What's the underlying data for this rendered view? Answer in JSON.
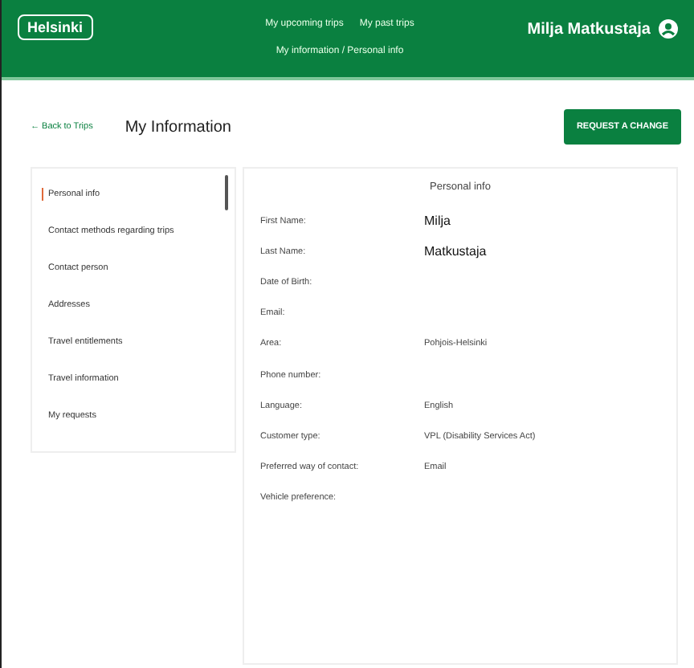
{
  "header": {
    "logo": "Helsinki",
    "nav": [
      {
        "label": "My upcoming trips",
        "selected": false
      },
      {
        "label": "My past trips",
        "selected": false
      }
    ],
    "breadcrumb": "My information / Personal info",
    "user_name": "Milja Matkustaja"
  },
  "toolbar": {
    "back_link": "← Back to Trips",
    "title": "My Information",
    "action_button": "REQUEST A CHANGE"
  },
  "sidebar": {
    "items": [
      {
        "label": "Personal info",
        "selected": true
      },
      {
        "label": "Contact methods regarding trips",
        "selected": false
      },
      {
        "label": "Contact person",
        "selected": false
      },
      {
        "label": "Addresses",
        "selected": false
      },
      {
        "label": "Travel entitlements",
        "selected": false
      },
      {
        "label": "Travel information",
        "selected": false
      },
      {
        "label": "My requests",
        "selected": false
      }
    ]
  },
  "panel": {
    "title": "Personal info",
    "fields": [
      {
        "label": "First Name:",
        "value": "Milja",
        "kind": "large"
      },
      {
        "label": "Last Name:",
        "value": "Matkustaja",
        "kind": "large"
      },
      {
        "label": "Date of Birth:"
      },
      {
        "label": "Email:"
      },
      {
        "label": "Area:",
        "value": "Pohjois-Helsinki",
        "kind": "small"
      },
      {
        "label": "Phone number:"
      },
      {
        "label": "Language:",
        "value": "English",
        "kind": "small"
      },
      {
        "label": "Customer type:",
        "value": "VPL (Disability Services Act)",
        "kind": "small"
      },
      {
        "label": "Preferred way of contact:",
        "value": "Email",
        "kind": "small"
      },
      {
        "label": "Vehicle preference:"
      }
    ]
  }
}
